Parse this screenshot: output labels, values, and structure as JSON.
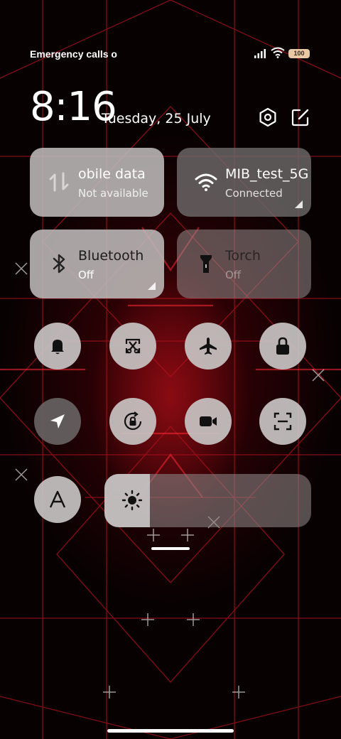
{
  "status_bar": {
    "carrier_text": "Emergency calls o",
    "battery_level": "100"
  },
  "header": {
    "time": "8:16",
    "date": "Tuesday, 25 July",
    "settings_icon": "settings-hexagon-icon",
    "edit_icon": "edit-icon"
  },
  "tiles": {
    "mobile_data": {
      "title": "Mobile data",
      "visible_title": "obile data",
      "status": "Not available",
      "icon": "data-arrows-icon"
    },
    "wifi": {
      "title": "MIB_test_5G",
      "status": "Connected",
      "icon": "wifi-icon"
    },
    "bluetooth": {
      "title": "Bluetooth",
      "status": "Off",
      "icon": "bluetooth-icon"
    },
    "torch": {
      "title": "Torch",
      "status": "Off",
      "icon": "torch-icon"
    }
  },
  "toggles": [
    {
      "name": "bell-icon",
      "state": "on"
    },
    {
      "name": "screenshot-icon",
      "state": "on"
    },
    {
      "name": "airplane-icon",
      "state": "on"
    },
    {
      "name": "lock-icon",
      "state": "on"
    },
    {
      "name": "location-icon",
      "state": "off"
    },
    {
      "name": "rotation-lock-icon",
      "state": "on"
    },
    {
      "name": "video-camera-icon",
      "state": "on"
    },
    {
      "name": "scanner-icon",
      "state": "on"
    },
    {
      "name": "font-icon",
      "state": "on"
    }
  ],
  "brightness": {
    "level": 0.22,
    "icon": "sun-icon"
  },
  "colors": {
    "tile_light": "#bdb8b8",
    "tile_dark": "#6b6666",
    "wallpaper_red": "#c8141e"
  }
}
